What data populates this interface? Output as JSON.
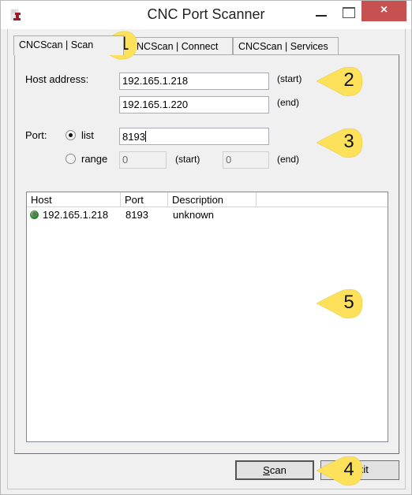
{
  "window": {
    "title": "CNC Port Scanner",
    "icon": "app-icon",
    "controls": {
      "minimize": "minimize-icon",
      "maximize": "maximize-icon",
      "close": "×"
    }
  },
  "tabs": [
    {
      "label": "CNCScan | Scan",
      "active": true
    },
    {
      "label": "CNCScan | Connect",
      "active": false
    },
    {
      "label": "CNCScan | Services",
      "active": false
    }
  ],
  "host": {
    "label": "Host address:",
    "start_value": "192.165.1.218",
    "start_label": "(start)",
    "end_value": "192.165.1.220",
    "end_label": "(end)"
  },
  "port": {
    "label": "Port:",
    "list_label": "list",
    "list_selected": true,
    "list_value": "8193",
    "range_label": "range",
    "range_selected": false,
    "range_start_value": "0",
    "range_start_label": "(start)",
    "range_end_value": "0",
    "range_end_label": "(end)"
  },
  "results": {
    "columns": [
      "Host",
      "Port",
      "Description",
      ""
    ],
    "rows": [
      {
        "status_icon": "host-online-icon",
        "host": "192.165.1.218",
        "port": "8193",
        "description": "unknown"
      }
    ]
  },
  "buttons": {
    "scan_accel": "S",
    "scan_rest": "can",
    "exit_label": "Exit"
  },
  "callouts": [
    "1",
    "2",
    "3",
    "4",
    "5"
  ],
  "colors": {
    "close_button": "#c75050",
    "callout_fill": "#fde15a",
    "window_bg": "#f0f0f0"
  }
}
